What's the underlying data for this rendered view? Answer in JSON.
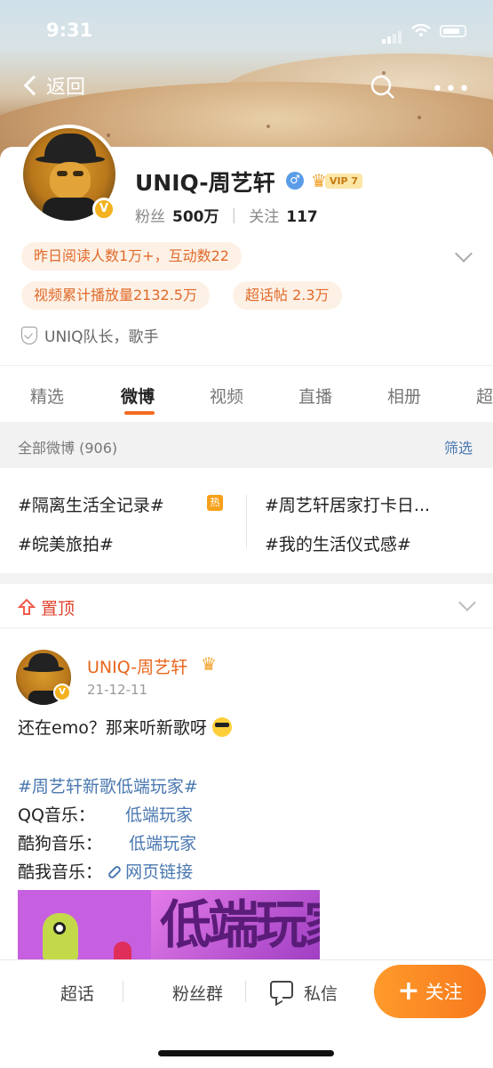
{
  "status_bar": {
    "time": "9:31"
  },
  "nav": {
    "back_label": "返回",
    "more": "•••"
  },
  "profile": {
    "name": "UNIQ-周艺轩",
    "vip_tag": "VIP 7",
    "verified_badge": "V",
    "male_symbol": "♂",
    "fans_label": "粉丝",
    "fans_count": "500万",
    "following_label": "关注",
    "following_count": "117",
    "pill_read": "昨日阅读人数1万+，互动数22",
    "pill_video": "视频累计播放量2132.5万",
    "pill_super": "超话帖 2.3万",
    "intro": "UNIQ队长，歌手"
  },
  "tabs": [
    {
      "label": "精选"
    },
    {
      "label": "微博"
    },
    {
      "label": "视频"
    },
    {
      "label": "直播"
    },
    {
      "label": "相册"
    },
    {
      "label": "超"
    }
  ],
  "feed_head": {
    "all_label": "全部微博 (906)",
    "filter_label": "筛选"
  },
  "topics": [
    {
      "label": "#隔离生活全记录#",
      "hot": "热"
    },
    {
      "label": "#周艺轩居家打卡日..."
    },
    {
      "label": "#皖美旅拍#"
    },
    {
      "label": "#我的生活仪式感#"
    }
  ],
  "pinned": {
    "label": "置顶"
  },
  "post": {
    "author": "UNIQ-周艺轩",
    "date": "21-12-11",
    "line1": "还在emo？那来听新歌呀",
    "hashtag": "#周艺轩新歌低端玩家#",
    "qq_label": "QQ音乐：",
    "qq_link": "低端玩家",
    "kugou_label": "酷狗音乐：",
    "kugou_link": "低端玩家",
    "kuwo_label": "酷我音乐：",
    "kuwo_link": "网页链接",
    "image_text": "低端玩家"
  },
  "bottom_bar": {
    "super_topic": "超话",
    "fan_group": "粉丝群",
    "message": "私信",
    "follow": "关注"
  },
  "colors": {
    "accent": "#f26b21",
    "link": "#4a78b0",
    "follow_bg": "#f77a1e"
  }
}
